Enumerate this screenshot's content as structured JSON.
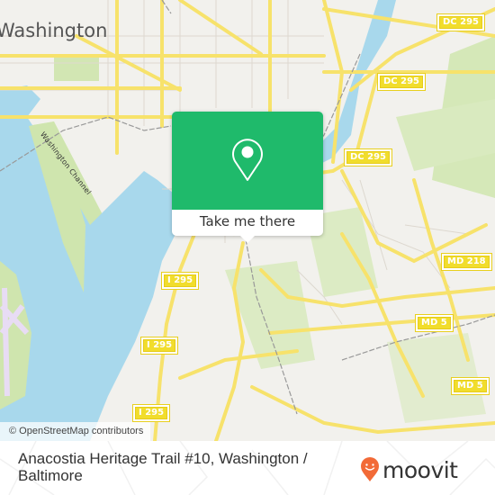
{
  "map": {
    "city_label": "Washington",
    "water_label": "Washington Channel",
    "road_shields": [
      {
        "text": "DC 295",
        "id": "dc295-top"
      },
      {
        "text": "DC 295",
        "id": "dc295-mid"
      },
      {
        "text": "DC 295",
        "id": "dc295-low"
      },
      {
        "text": "MD 218",
        "id": "md218"
      },
      {
        "text": "MD 5",
        "id": "md5-upper"
      },
      {
        "text": "MD 5",
        "id": "md5-lower"
      },
      {
        "text": "I 295",
        "id": "i295-upper"
      },
      {
        "text": "I 295",
        "id": "i295-mid"
      },
      {
        "text": "I 295",
        "id": "i295-lower"
      }
    ],
    "attribution": "© OpenStreetMap contributors",
    "colors": {
      "land": "#f2f1ed",
      "water": "#a8d8ec",
      "park": "#cfe5ae",
      "road": "#f7e26b",
      "airport": "#e8dcf4"
    }
  },
  "popup": {
    "icon": "map-pin-icon",
    "button_label": "Take me there",
    "accent_color": "#1fba6b"
  },
  "footer": {
    "title": "Anacostia Heritage Trail #10, Washington / Baltimore",
    "logo_text": "moovit",
    "logo_icon": "moovit-pin-icon",
    "logo_color": "#f26a37"
  }
}
